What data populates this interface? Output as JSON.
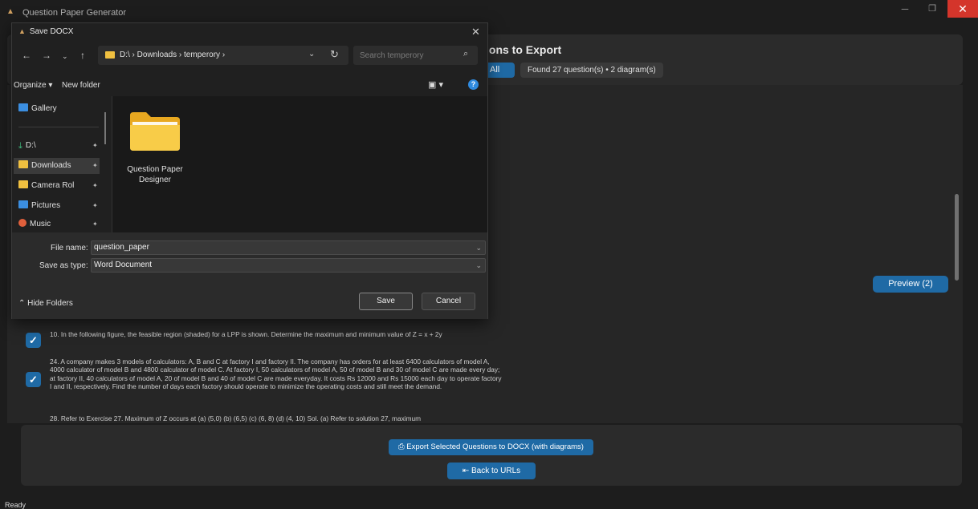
{
  "app": {
    "title": "Question Paper Generator",
    "status": "Ready"
  },
  "main": {
    "panel_title_partial": "ions to Export",
    "select_all_partial": "All",
    "found_label": "Found 27 question(s) • 2 diagram(s)",
    "preview_button": "Preview (2)",
    "questions": [
      {
        "checked": true,
        "text": "10. In the following figure, the feasible region (shaded) for a LPP is shown. Determine the maximum and minimum value of Z = x + 2y"
      },
      {
        "checked": true,
        "text": "24. A company makes 3 models of calculators: A, B and C at factory I and factory II. The company has orders for at least 6400 calculators of model A, 4000 calculator of model B and 4800 calculator of model C. At factory I, 50 calculators of model A, 50 of model B and 30 of model C are made every day; at factory II, 40 calculators of model A, 20 of model B and 40 of model C are made everyday. It costs Rs 12000 and Rs 15000 each day to operate factory I and II, respectively. Find the number of days each factory should operate to minimize the operating costs and still meet the demand."
      },
      {
        "checked": false,
        "text": "28. Refer to Exercise 27. Maximum of Z occurs at (a) (5,0) (b) (6,5) (c) (6, 8) (d) (4, 10) Sol. (a) Refer to solution 27, maximum"
      }
    ],
    "export_button": "Export Selected Questions to DOCX (with diagrams)",
    "back_button": "Back to URLs"
  },
  "dialog": {
    "title": "Save DOCX",
    "address": "D:\\  ›  Downloads  ›  temperory  ›",
    "search_placeholder": "Search temperory",
    "organize": "Organize ▾",
    "new_folder": "New folder",
    "nav_items": [
      {
        "label": "Gallery",
        "icon": "gallery-icon",
        "pinned": false
      },
      {
        "label": "D:\\",
        "icon": "drive-icon",
        "pinned": true
      },
      {
        "label": "Downloads",
        "icon": "folder-icon",
        "pinned": true
      },
      {
        "label": "Camera Rol",
        "icon": "folder-icon",
        "pinned": true
      },
      {
        "label": "Pictures",
        "icon": "pictures-icon",
        "pinned": true
      },
      {
        "label": "Music",
        "icon": "music-icon",
        "pinned": true
      }
    ],
    "folder_name": "Question Paper Designer",
    "file_name_label": "File name:",
    "file_name_value": "question_paper",
    "save_type_label": "Save as type:",
    "save_type_value": "Word Document",
    "hide_folders": "Hide Folders",
    "save_button": "Save",
    "cancel_button": "Cancel"
  },
  "colors": {
    "accent": "#1f6aa5",
    "close": "#d4352b",
    "folder": "#f0c040"
  }
}
